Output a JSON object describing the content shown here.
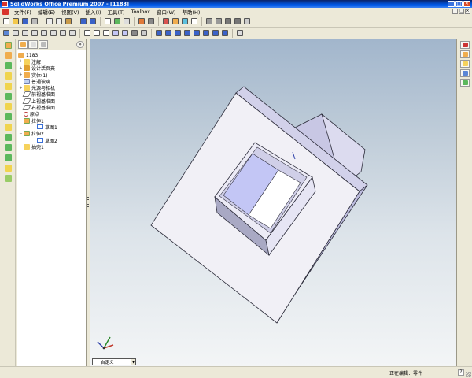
{
  "window": {
    "title": "SolidWorks Office Premium 2007 - [1183]",
    "controls": {
      "minimize": "_",
      "maximize": "□",
      "close": "×"
    }
  },
  "menubar": {
    "items": [
      "文件(F)",
      "编辑(E)",
      "视图(V)",
      "插入(I)",
      "工具(T)",
      "Toolbox",
      "窗口(W)",
      "帮助(H)"
    ]
  },
  "toolbar1": {
    "buttons": [
      "new-icon",
      "open-icon",
      "save-icon",
      "print-icon",
      "print-preview-icon",
      "cut-icon",
      "copy-icon",
      "paste-icon",
      "undo-icon",
      "redo-icon",
      "select-icon",
      "rebuild-icon",
      "options-icon"
    ]
  },
  "toolbar2": {
    "buttons": [
      "zoom-fit-icon",
      "zoom-area-icon",
      "zoom-in-out-icon",
      "zoom-selection-icon",
      "rotate-icon",
      "pan-icon",
      "wireframe-icon",
      "hidden-lines-icon",
      "shaded-icon",
      "perspective-icon",
      "section-view-icon",
      "view-orientation-icon"
    ]
  },
  "feature_manager": {
    "root": "1183",
    "items": [
      {
        "label": "注解",
        "icon": "annotations-icon",
        "expand": "+"
      },
      {
        "label": "设计活页夹",
        "icon": "design-binder-icon",
        "expand": "+"
      },
      {
        "label": "实体(1)",
        "icon": "solid-bodies-icon",
        "expand": "+"
      },
      {
        "label": "普通玻璃",
        "icon": "material-icon",
        "expand": ""
      },
      {
        "label": "光源与相机",
        "icon": "lights-cameras-icon",
        "expand": "+"
      },
      {
        "label": "前视基准面",
        "icon": "plane-icon",
        "expand": ""
      },
      {
        "label": "上视基准面",
        "icon": "plane-icon",
        "expand": ""
      },
      {
        "label": "右视基准面",
        "icon": "plane-icon",
        "expand": ""
      },
      {
        "label": "原点",
        "icon": "origin-icon",
        "expand": ""
      },
      {
        "label": "拉伸1",
        "icon": "extrude-icon",
        "expand": "−"
      },
      {
        "label": "草图1",
        "icon": "sketch-icon",
        "expand": "",
        "indent": true
      },
      {
        "label": "拉伸2",
        "icon": "extrude-icon",
        "expand": "−"
      },
      {
        "label": "草图2",
        "icon": "sketch-icon",
        "expand": "",
        "indent": true
      },
      {
        "label": "抽壳1",
        "icon": "shell-icon",
        "expand": ""
      }
    ],
    "collapse_label": "»"
  },
  "viewport": {
    "view_orientation": "自定义"
  },
  "statusbar": {
    "text": "正在编辑：零件",
    "help": "?"
  },
  "colors": {
    "titlebar": "#0058e6",
    "viewport_top": "#a2b6cc",
    "viewport_bottom": "#f3f5f6",
    "part_face": "#f1f0f6",
    "part_side": "#c8c7e4",
    "selected_face": "#c3c6f5"
  }
}
